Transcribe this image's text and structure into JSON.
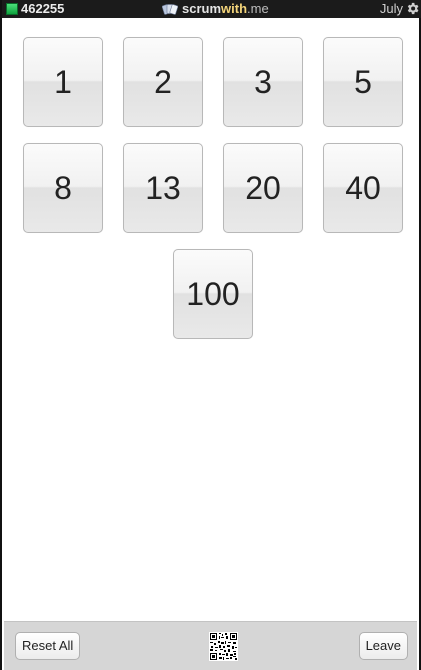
{
  "topbar": {
    "room_id": "462255",
    "brand_scrum": "scrum",
    "brand_with": "with",
    "brand_me": ".me",
    "user_name": "July",
    "room_status_color": "#1fc04f"
  },
  "cards": [
    {
      "label": "1"
    },
    {
      "label": "2"
    },
    {
      "label": "3"
    },
    {
      "label": "5"
    },
    {
      "label": "8"
    },
    {
      "label": "13"
    },
    {
      "label": "20"
    },
    {
      "label": "40"
    },
    {
      "label": "100"
    }
  ],
  "footer": {
    "reset_label": "Reset All",
    "leave_label": "Leave",
    "qr_icon": "qr-code-icon"
  },
  "icons": {
    "brand": "playing-cards-icon",
    "settings": "gear-icon"
  }
}
